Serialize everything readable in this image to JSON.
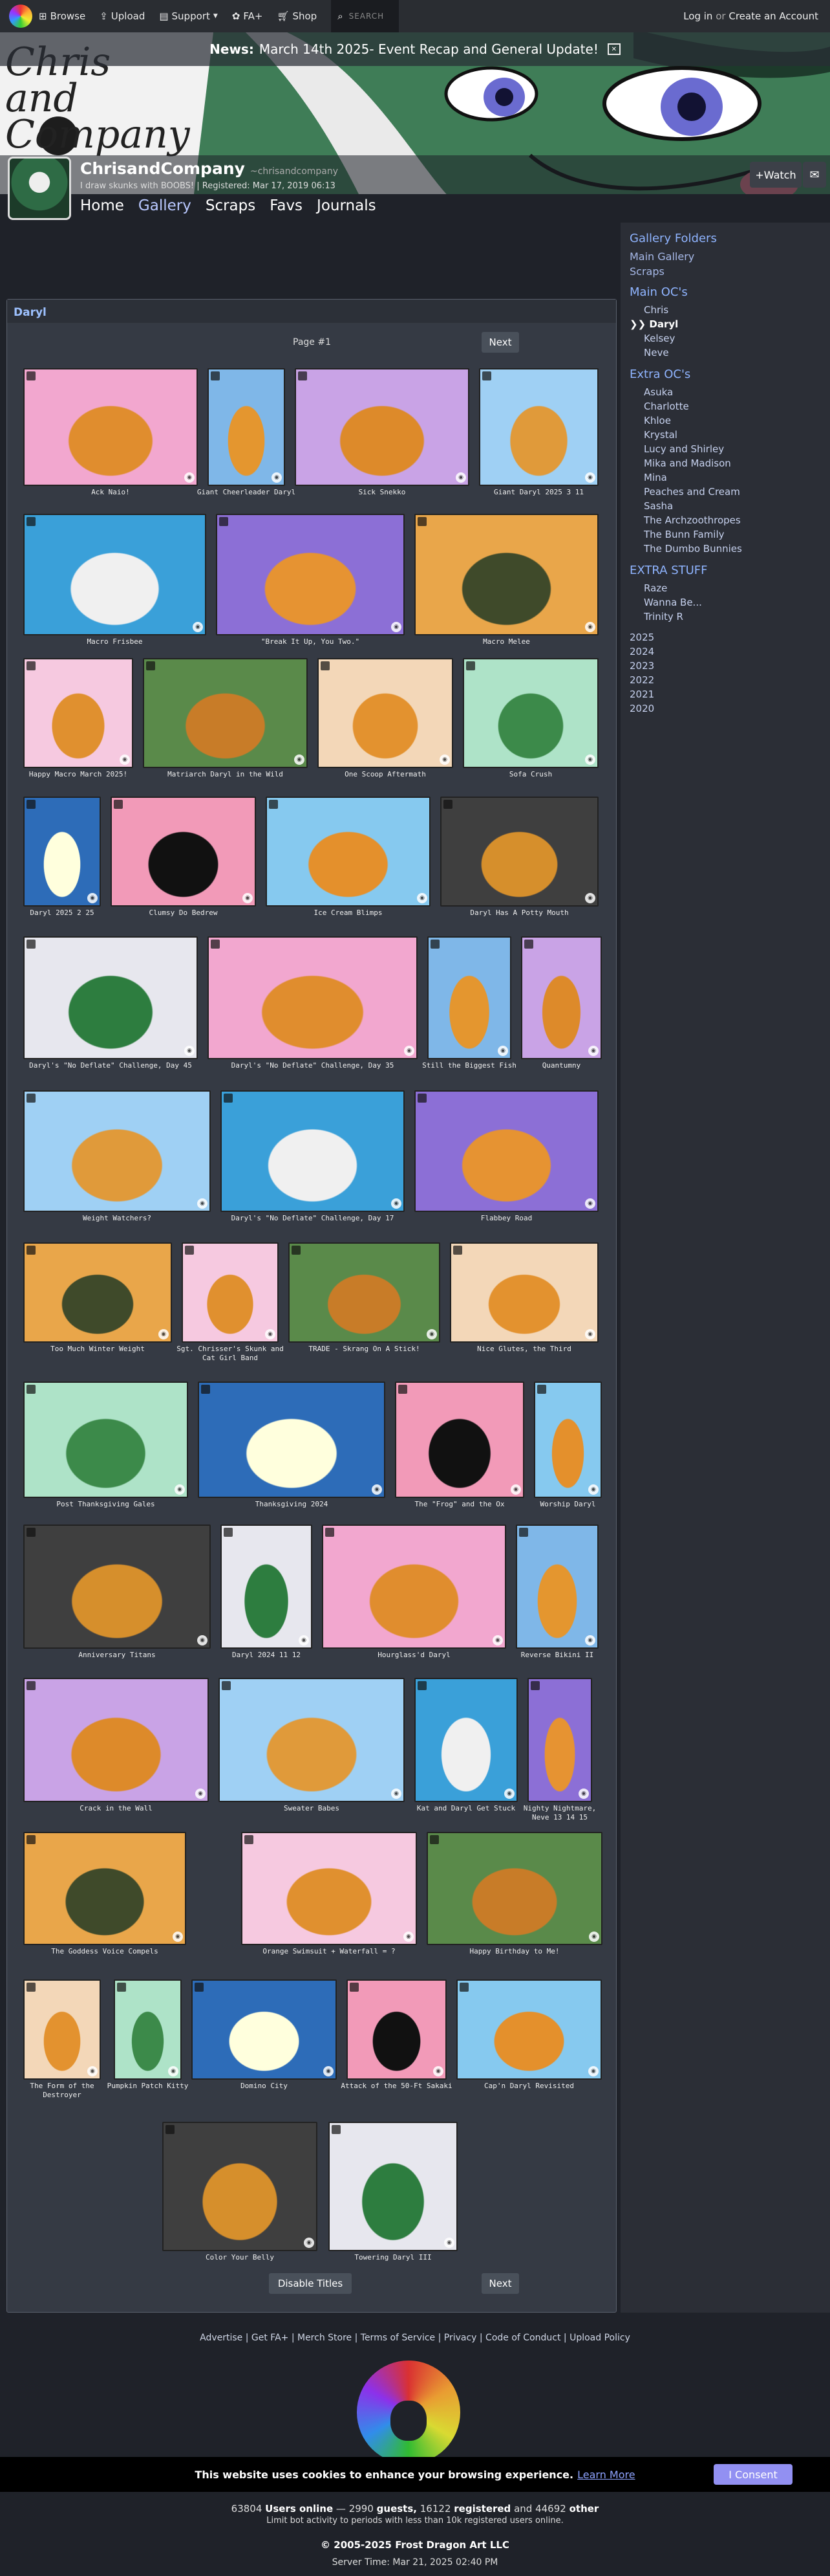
{
  "topnav": {
    "browse": "Browse",
    "upload": "Upload",
    "support": "Support",
    "fa_plus": "FA+",
    "shop": "Shop",
    "search_placeholder": "SEARCH",
    "login": "Log in",
    "or": "or",
    "create": "Create an Account"
  },
  "news": {
    "label": "News:",
    "text": "March 14th 2025- Event Recap and General Update!"
  },
  "banner": {
    "logo_text": "Chris and Company"
  },
  "profile": {
    "name": "ChrisandCompany",
    "handle": "~chrisandcompany",
    "tagline": "I draw skunks with BOOBS! | Registered: Mar 17, 2019 06:13",
    "watch": "+Watch"
  },
  "subnav": [
    "Home",
    "Gallery",
    "Scraps",
    "Favs",
    "Journals"
  ],
  "gallery": {
    "title": "Daryl",
    "page": "Page #1",
    "next": "Next",
    "disable_titles": "Disable Titles"
  },
  "sidebar": {
    "title": "Gallery Folders",
    "main_gallery": "Main Gallery",
    "scraps": "Scraps",
    "main_ocs": "Main OC's",
    "main_items": [
      "Chris",
      "Daryl",
      "Kelsey",
      "Neve"
    ],
    "selected_prefix": "❯❯",
    "extra_ocs": "Extra OC's",
    "extra_items": [
      "Asuka",
      "Charlotte",
      "Khloe",
      "Krystal",
      "Lucy and Shirley",
      "Mika and Madison",
      "Mina",
      "Peaches and Cream",
      "Sasha",
      "The Archzoothropes",
      "The Bunn Family",
      "The Dumbo Bunnies"
    ],
    "extra_stuff": "EXTRA STUFF",
    "stuff_items": [
      "Raze",
      "Wanna Be...",
      "Trinity R"
    ],
    "years": [
      "2025",
      "2024",
      "2023",
      "2022",
      "2021",
      "2020"
    ]
  },
  "thumbs": [
    "Ack Naio!",
    "Giant Cheerleader Daryl",
    "Sick Snekko",
    "Giant Daryl 2025 3 11",
    "Macro Frisbee",
    "\"Break It Up, You Two.\"",
    "Macro Melee",
    "Happy Macro March 2025!",
    "Matriarch Daryl in the Wild",
    "One Scoop Aftermath",
    "Sofa Crush",
    "Daryl 2025 2 25",
    "Clumsy Do Bedrew",
    "Ice Cream Blimps",
    "Daryl Has A Potty Mouth",
    "Daryl's \"No Deflate\" Challenge, Day 45",
    "Daryl's \"No Deflate\" Challenge, Day 35",
    "Still the Biggest Fish",
    "Quantumny",
    "Weight Watchers?",
    "Daryl's \"No Deflate\" Challenge, Day 17",
    "Flabbey Road",
    "Too Much Winter Weight",
    "Sgt. Chrisser's Skunk and Cat Girl Band",
    "TRADE - Skrang On A Stick!",
    "Nice Glutes, the Third",
    "Post Thanksgiving Gales",
    "Thanksgiving 2024",
    "The \"Frog\" and the Ox",
    "Worship Daryl",
    "Anniversary Titans",
    "Daryl 2024 11 12",
    "Hourglass'd Daryl",
    "Reverse Bikini II",
    "Crack in the Wall",
    "Sweater Babes",
    "Kat and Daryl Get Stuck",
    "Nighty Nightmare, Neve 13 14 15",
    "The Goddess Voice Compels",
    "Orange Swimsuit + Waterfall = ?",
    "Happy Birthday to Me!",
    "The Form of the Destroyer",
    "Pumpkin Patch Kitty",
    "Domino City",
    "Attack of the 50-Ft Sakaki",
    "Cap'n Daryl Revisited",
    "Color Your Belly",
    "Towering Daryl III"
  ],
  "footer": {
    "links": "Advertise | Get FA+ | Merch Store | Terms of Service | Privacy | Code of Conduct | Upload Policy"
  },
  "cookie": {
    "text": "This website uses cookies to enhance your browsing experience.",
    "learn": "Learn More",
    "ok": "I Consent"
  },
  "stats": {
    "online": "63804",
    "online_lbl": "Users online",
    "guests": "2990",
    "guests_lbl": "guests,",
    "registered": "16122",
    "registered_lbl": "registered",
    "other": "44692",
    "other_lbl": "other",
    "sep1": "—",
    "and": "and",
    "note": "Limit bot activity to periods with less than 10k registered users online."
  },
  "copyright": "© 2005-2025 Frost Dragon Art LLC",
  "server_time": "Server Time: Mar 21, 2025 02:40 PM"
}
